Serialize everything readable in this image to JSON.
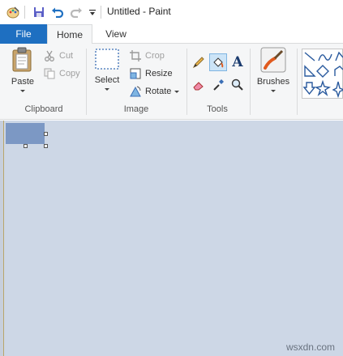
{
  "window": {
    "title": "Untitled - Paint"
  },
  "quick_access": {
    "icons": [
      "paint-app-icon",
      "save-icon",
      "undo-icon",
      "redo-icon",
      "customize-dropdown-icon"
    ]
  },
  "tabs": [
    {
      "label": "File",
      "selected": false
    },
    {
      "label": "Home",
      "selected": true
    },
    {
      "label": "View",
      "selected": false
    }
  ],
  "ribbon": {
    "clipboard": {
      "label": "Clipboard",
      "paste": "Paste",
      "cut": "Cut",
      "copy": "Copy"
    },
    "image": {
      "label": "Image",
      "select": "Select",
      "crop": "Crop",
      "resize": "Resize",
      "rotate": "Rotate"
    },
    "tools": {
      "label": "Tools",
      "active_tool": "fill-with-color"
    },
    "brushes": {
      "label": "Brushes"
    }
  },
  "colors": {
    "file_tab": "#1e6fc1",
    "ribbon_bg": "#f5f6f7",
    "workspace_bg": "#cdd7e6",
    "canvas_fill": "#7c98c4"
  },
  "watermark": "wsxdn.com"
}
